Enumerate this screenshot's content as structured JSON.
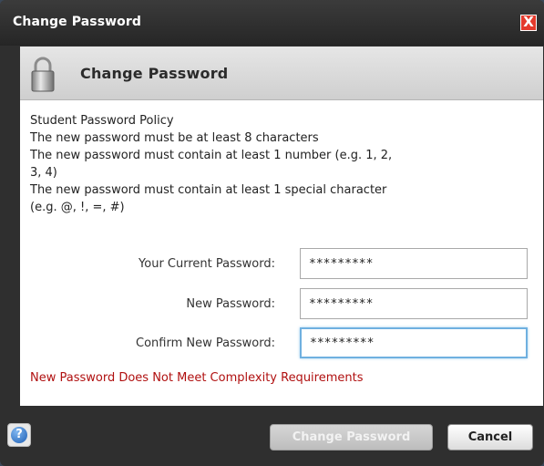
{
  "dialog": {
    "title": "Change Password",
    "close_label": "X"
  },
  "panel": {
    "heading": "Change Password",
    "policy_lines": [
      "Student Password Policy",
      "The new password must be at least 8 characters",
      "The new password must contain at least 1 number (e.g. 1, 2,",
      "3, 4)",
      "The new password must contain at least 1 special character",
      "(e.g. @, !, =, #)"
    ],
    "fields": {
      "current_label": "Your Current Password:",
      "current_value": "*********",
      "new_label": "New Password:",
      "new_value": "*********",
      "confirm_label": "Confirm New Password:",
      "confirm_value": "*********"
    },
    "error_message": "New Password Does Not Meet Complexity Requirements"
  },
  "footer": {
    "help_label": "?",
    "change_button": "Change Password",
    "cancel_button": "Cancel"
  },
  "colors": {
    "error": "#b01010",
    "focus_border": "#6fb0e0",
    "close_bg": "#e43a2c"
  }
}
